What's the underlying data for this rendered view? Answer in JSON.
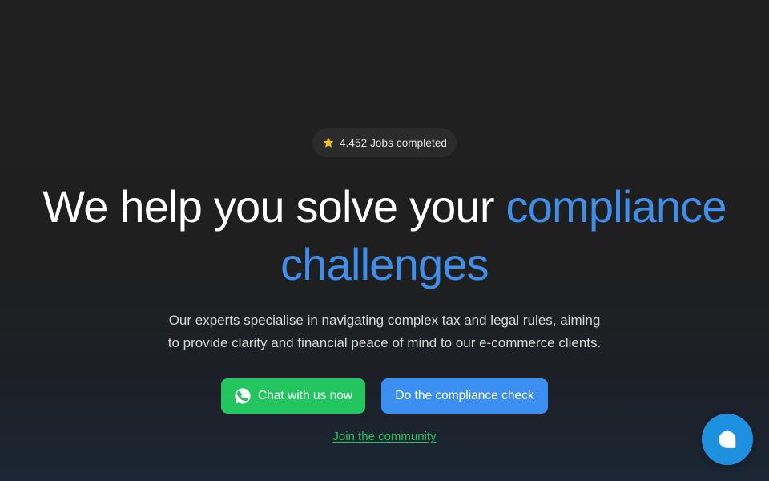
{
  "badge": {
    "icon": "star-icon",
    "icon_color": "#f5c518",
    "text": "4.452 Jobs completed"
  },
  "headline": {
    "part1": "We help you solve your ",
    "accent_line1": "compliance",
    "accent_line2": "challenges",
    "accent_color": "#3f8eea"
  },
  "subtext": {
    "line1": "Our experts specialise in navigating complex tax and legal rules, aiming",
    "line2": "to provide clarity and financial peace of mind to our e-commerce clients."
  },
  "buttons": {
    "chat": {
      "label": "Chat with us now",
      "icon": "whatsapp-icon",
      "color": "#22c55e"
    },
    "check": {
      "label": "Do the compliance check",
      "color": "#3b8ff0"
    }
  },
  "community_link": {
    "label": "Join the community",
    "color": "#22c55e"
  },
  "chat_widget": {
    "icon": "chat-bubble-icon",
    "color": "#1e90e0"
  }
}
